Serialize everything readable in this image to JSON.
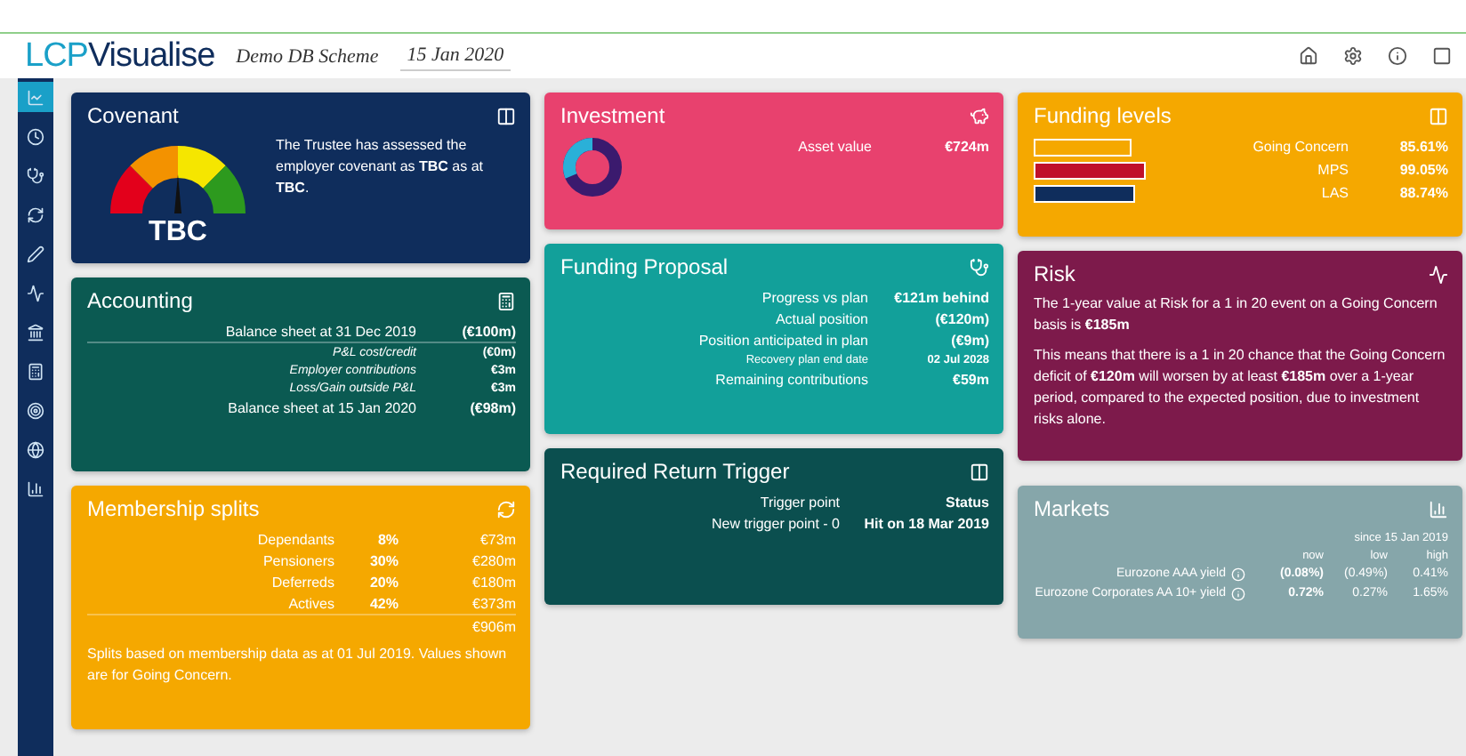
{
  "header": {
    "logo_prefix": "LCP",
    "logo_suffix": "Visualise",
    "scheme": "Demo DB Scheme",
    "date": "15 Jan 2020"
  },
  "sidebar": {
    "items": [
      {
        "selected": true
      },
      {
        "selected": false
      },
      {
        "selected": false
      },
      {
        "selected": false
      },
      {
        "selected": false
      },
      {
        "selected": false
      },
      {
        "selected": false
      },
      {
        "selected": false
      },
      {
        "selected": false
      },
      {
        "selected": false
      },
      {
        "selected": false
      }
    ]
  },
  "covenant": {
    "title": "Covenant",
    "gauge_label": "TBC",
    "text": "The Trustee has assessed the employer covenant as **TBC** as at **TBC**."
  },
  "accounting": {
    "title": "Accounting",
    "rows": [
      {
        "label": "Balance sheet at 31 Dec 2019",
        "value": "(€100m)",
        "kind": "main"
      },
      {
        "label": "P&L cost/credit",
        "value": "(€0m)",
        "kind": "sub"
      },
      {
        "label": "Employer contributions",
        "value": "€3m",
        "kind": "sub"
      },
      {
        "label": "Loss/Gain outside P&L",
        "value": "€3m",
        "kind": "sub"
      },
      {
        "label": "Balance sheet at 15 Jan 2020",
        "value": "(€98m)",
        "kind": "main"
      }
    ]
  },
  "membership_splits": {
    "title": "Membership splits",
    "rows": [
      {
        "label": "Dependants",
        "share": "8%",
        "value": "€73m"
      },
      {
        "label": "Pensioners",
        "share": "30%",
        "value": "€280m"
      },
      {
        "label": "Deferreds",
        "share": "20%",
        "value": "€180m"
      },
      {
        "label": "Actives",
        "share": "42%",
        "value": "€373m"
      }
    ],
    "total": "€906m",
    "note": "Splits based on membership data as at 01 Jul 2019. Values shown are for Going Concern."
  },
  "investment": {
    "title": "Investment",
    "label": "Asset value",
    "value": "€724m"
  },
  "funding_proposal": {
    "title": "Funding Proposal",
    "rows": [
      {
        "label": "Progress vs plan",
        "value": "€121m behind",
        "kind": "main"
      },
      {
        "label": "Actual position",
        "value": "(€120m)",
        "kind": "main"
      },
      {
        "label": "Position anticipated in plan",
        "value": "(€9m)",
        "kind": "main"
      },
      {
        "label": "Recovery plan end date",
        "value": "02 Jul 2028",
        "kind": "small"
      },
      {
        "label": "Remaining contributions",
        "value": "€59m",
        "kind": "main"
      }
    ]
  },
  "required_return_trigger": {
    "title": "Required Return Trigger",
    "rows": [
      {
        "label": "Trigger point",
        "value": "Status"
      },
      {
        "label": "New trigger point - 0",
        "value": "Hit on 18 Mar 2019"
      }
    ]
  },
  "funding_levels": {
    "title": "Funding levels",
    "rows": [
      {
        "label": "Going Concern",
        "value": "85.61%",
        "color": "#f5a800"
      },
      {
        "label": "MPS",
        "value": "99.05%",
        "color": "#c0102a"
      },
      {
        "label": "LAS",
        "value": "88.74%",
        "color": "#0f2d5c"
      }
    ]
  },
  "risk": {
    "title": "Risk",
    "paragraphs": [
      "The 1-year value at Risk for a 1 in 20 event on a Going Concern basis is **€185m**",
      "This means that there is a 1 in 20 chance that the Going Concern deficit of **€120m** will worsen by at least **€185m** over a 1-year period, compared to the expected position, due to investment risks alone."
    ]
  },
  "markets": {
    "title": "Markets",
    "since": "since 15 Jan 2019",
    "columns": [
      "now",
      "low",
      "high"
    ],
    "rows": [
      {
        "label": "Eurozone AAA yield",
        "values": [
          "(0.08%)",
          "(0.49%)",
          "0.41%"
        ]
      },
      {
        "label": "Eurozone Corporates AA 10+ yield",
        "values": [
          "0.72%",
          "0.27%",
          "1.65%"
        ]
      }
    ]
  }
}
